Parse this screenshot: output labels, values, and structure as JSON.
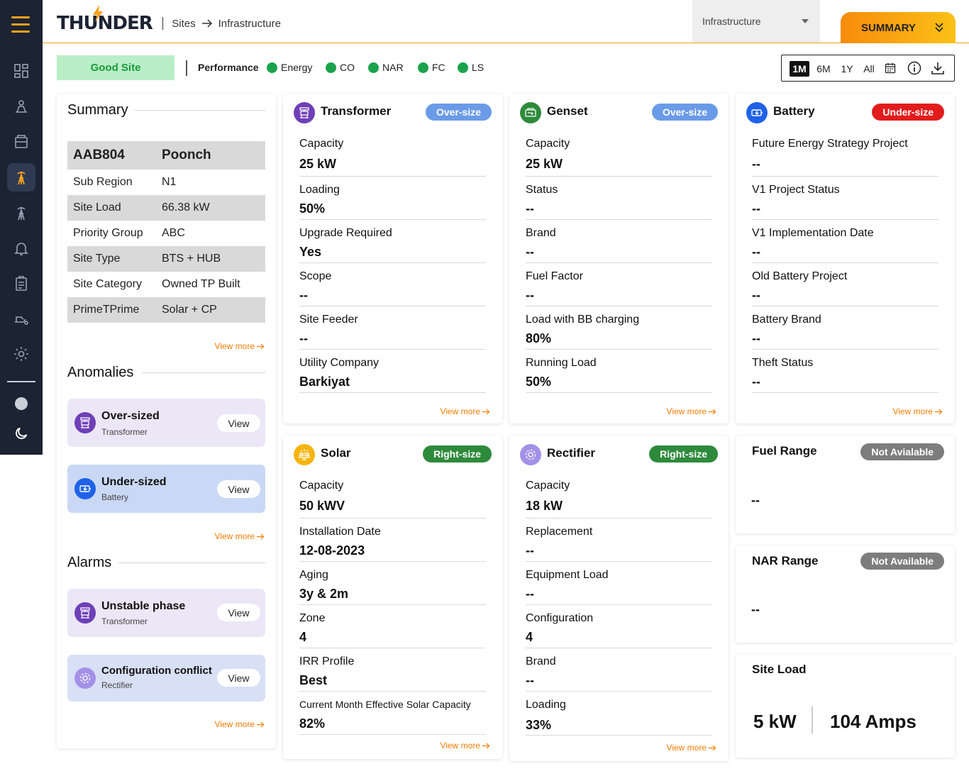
{
  "brand": {
    "logo_text": "THUNDER"
  },
  "breadcrumb": {
    "sites": "Sites",
    "current": "Infrastructure"
  },
  "view_select": {
    "value": "Infrastructure"
  },
  "summary_button": {
    "label": "SUMMARY"
  },
  "filters": {
    "site_status": "Good Site",
    "performance_label": "Performance",
    "legend": [
      "Energy",
      "CO",
      "NAR",
      "FC",
      "LS"
    ],
    "legend_color": "#1aa34a",
    "ranges": [
      "1M",
      "6M",
      "1Y",
      "All"
    ],
    "active_range": "1M"
  },
  "summary": {
    "title": "Summary",
    "site_id": "AAB804",
    "site_name": "Poonch",
    "rows": [
      {
        "key": "Sub Region",
        "value": "N1"
      },
      {
        "key": "Site Load",
        "value": "66.38 kW"
      },
      {
        "key": "Priority Group",
        "value": "ABC"
      },
      {
        "key": "Site Type",
        "value": "BTS + HUB"
      },
      {
        "key": "Site Category",
        "value": "Owned TP Built"
      },
      {
        "key": "PrimeTPrime",
        "value": "Solar + CP"
      }
    ],
    "view_more": "View more"
  },
  "anomalies": {
    "title": "Anomalies",
    "items": [
      {
        "title": "Over-sized",
        "subtitle": "Transformer",
        "action": "View"
      },
      {
        "title": "Under-sized",
        "subtitle": "Battery",
        "action": "View"
      }
    ],
    "view_more": "View more"
  },
  "alarms": {
    "title": "Alarms",
    "items": [
      {
        "title": "Unstable phase",
        "subtitle": "Transformer",
        "action": "View"
      },
      {
        "title": "Configuration conflict",
        "subtitle": "Rectifier",
        "action": "View"
      }
    ],
    "view_more": "View more"
  },
  "transformer": {
    "title": "Transformer",
    "badge": "Over-size",
    "fields": [
      {
        "label": "Capacity",
        "value": "25 kW"
      },
      {
        "label": "Loading",
        "value": "50%"
      },
      {
        "label": "Upgrade Required",
        "value": "Yes"
      },
      {
        "label": "Scope",
        "value": "--"
      },
      {
        "label": "Site Feeder",
        "value": "--"
      },
      {
        "label": "Utility Company",
        "value": "Barkiyat"
      }
    ],
    "view_more": "View more"
  },
  "genset": {
    "title": "Genset",
    "badge": "Over-size",
    "fields": [
      {
        "label": "Capacity",
        "value": "25 kW"
      },
      {
        "label": "Status",
        "value": "--"
      },
      {
        "label": "Brand",
        "value": "--"
      },
      {
        "label": "Fuel Factor",
        "value": "--"
      },
      {
        "label": "Load with BB charging",
        "value": "80%"
      },
      {
        "label": "Running Load",
        "value": "50%"
      }
    ],
    "view_more": "View more"
  },
  "battery": {
    "title": "Battery",
    "badge": "Under-size",
    "fields": [
      {
        "label": "Future Energy Strategy Project",
        "value": "--"
      },
      {
        "label": "V1 Project Status",
        "value": "--"
      },
      {
        "label": "V1 Implementation Date",
        "value": "--"
      },
      {
        "label": "Old Battery Project",
        "value": "--"
      },
      {
        "label": "Battery Brand",
        "value": "--"
      },
      {
        "label": "Theft Status",
        "value": "--"
      }
    ],
    "view_more": "View more"
  },
  "solar": {
    "title": "Solar",
    "badge": "Right-size",
    "fields": [
      {
        "label": "Capacity",
        "value": "50 kWV"
      },
      {
        "label": "Installation Date",
        "value": "12-08-2023"
      },
      {
        "label": "Aging",
        "value": "3y & 2m"
      },
      {
        "label": "Zone",
        "value": "4"
      },
      {
        "label": "IRR Profile",
        "value": "Best"
      },
      {
        "label": "Current Month Effective Solar Capacity",
        "value": "82%"
      }
    ],
    "view_more": "View more"
  },
  "rectifier": {
    "title": "Rectifier",
    "badge": "Right-size",
    "fields": [
      {
        "label": "Capacity",
        "value": "18 kW"
      },
      {
        "label": "Replacement",
        "value": "--"
      },
      {
        "label": "Equipment Load",
        "value": "--"
      },
      {
        "label": "Configuration",
        "value": "4"
      },
      {
        "label": "Brand",
        "value": "--"
      },
      {
        "label": "Loading",
        "value": "33%"
      }
    ],
    "view_more": "View more"
  },
  "fuel_range": {
    "title": "Fuel Range",
    "badge": "Not Avialable",
    "value": "--"
  },
  "nar_range": {
    "title": "NAR Range",
    "badge": "Not Available",
    "value": "--"
  },
  "site_load": {
    "title": "Site Load",
    "kw": "5 kW",
    "amps": "104 Amps"
  },
  "colors": {
    "accent": "#f7a11a",
    "sidebar": "#1c2333",
    "good": "#1a9a3a",
    "link": "#f57c00"
  },
  "icons": {
    "sidebar": [
      "dashboard-icon",
      "sites-icon",
      "files-icon",
      "tower-icon",
      "tower-outline-icon",
      "bell-icon",
      "clipboard-icon",
      "fuel-icon",
      "settings-icon",
      "status-dot-icon",
      "moon-icon"
    ]
  }
}
